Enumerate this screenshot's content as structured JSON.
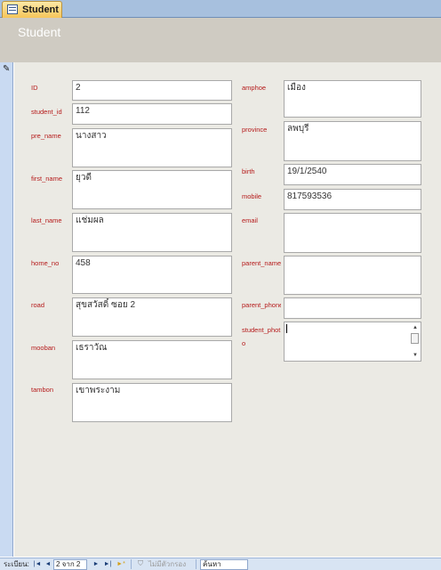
{
  "tab": {
    "label": "Student"
  },
  "form": {
    "title": "Student"
  },
  "left_fields": [
    {
      "label": "ID",
      "value": "2"
    },
    {
      "label": "student_id",
      "value": "112"
    },
    {
      "label": "pre_name",
      "value": "นางสาว"
    },
    {
      "label": "first_name",
      "value": "ยุวดี"
    },
    {
      "label": "last_name",
      "value": "แช่มผล"
    },
    {
      "label": "home_no",
      "value": "458"
    },
    {
      "label": "road",
      "value": "สุขสวัสดิ์ ซอย 2"
    },
    {
      "label": "mooban",
      "value": "เธราวัณ"
    },
    {
      "label": "tambon",
      "value": "เขาพระงาม"
    }
  ],
  "right_fields": [
    {
      "label": "amphoe",
      "value": "เมือง"
    },
    {
      "label": "province",
      "value": "ลพบุรี"
    },
    {
      "label": "birth",
      "value": "19/1/2540"
    },
    {
      "label": "mobile",
      "value": "817593536"
    },
    {
      "label": "email",
      "value": ""
    },
    {
      "label": "parent_name",
      "value": ""
    },
    {
      "label": "parent_phone",
      "value": ""
    },
    {
      "label": "student_photo",
      "value": ""
    }
  ],
  "right_labels_display": {
    "parent_phone": "parent_phone",
    "student_photo_line1": "student_phot",
    "student_photo_line2": "o"
  },
  "navbar": {
    "record_label": "ระเบียน:",
    "first": "|◄",
    "prev": "◄",
    "position": "2 จาก 2",
    "next": "►",
    "last": "►|",
    "new": "►*",
    "filter_label": "ไม่มีตัวกรอง",
    "search_label": "ค้นหา"
  },
  "colors": {
    "label": "#b51a1a",
    "header": "#cfcbc2",
    "body": "#ebeae4",
    "tab": "#f6c55a"
  }
}
